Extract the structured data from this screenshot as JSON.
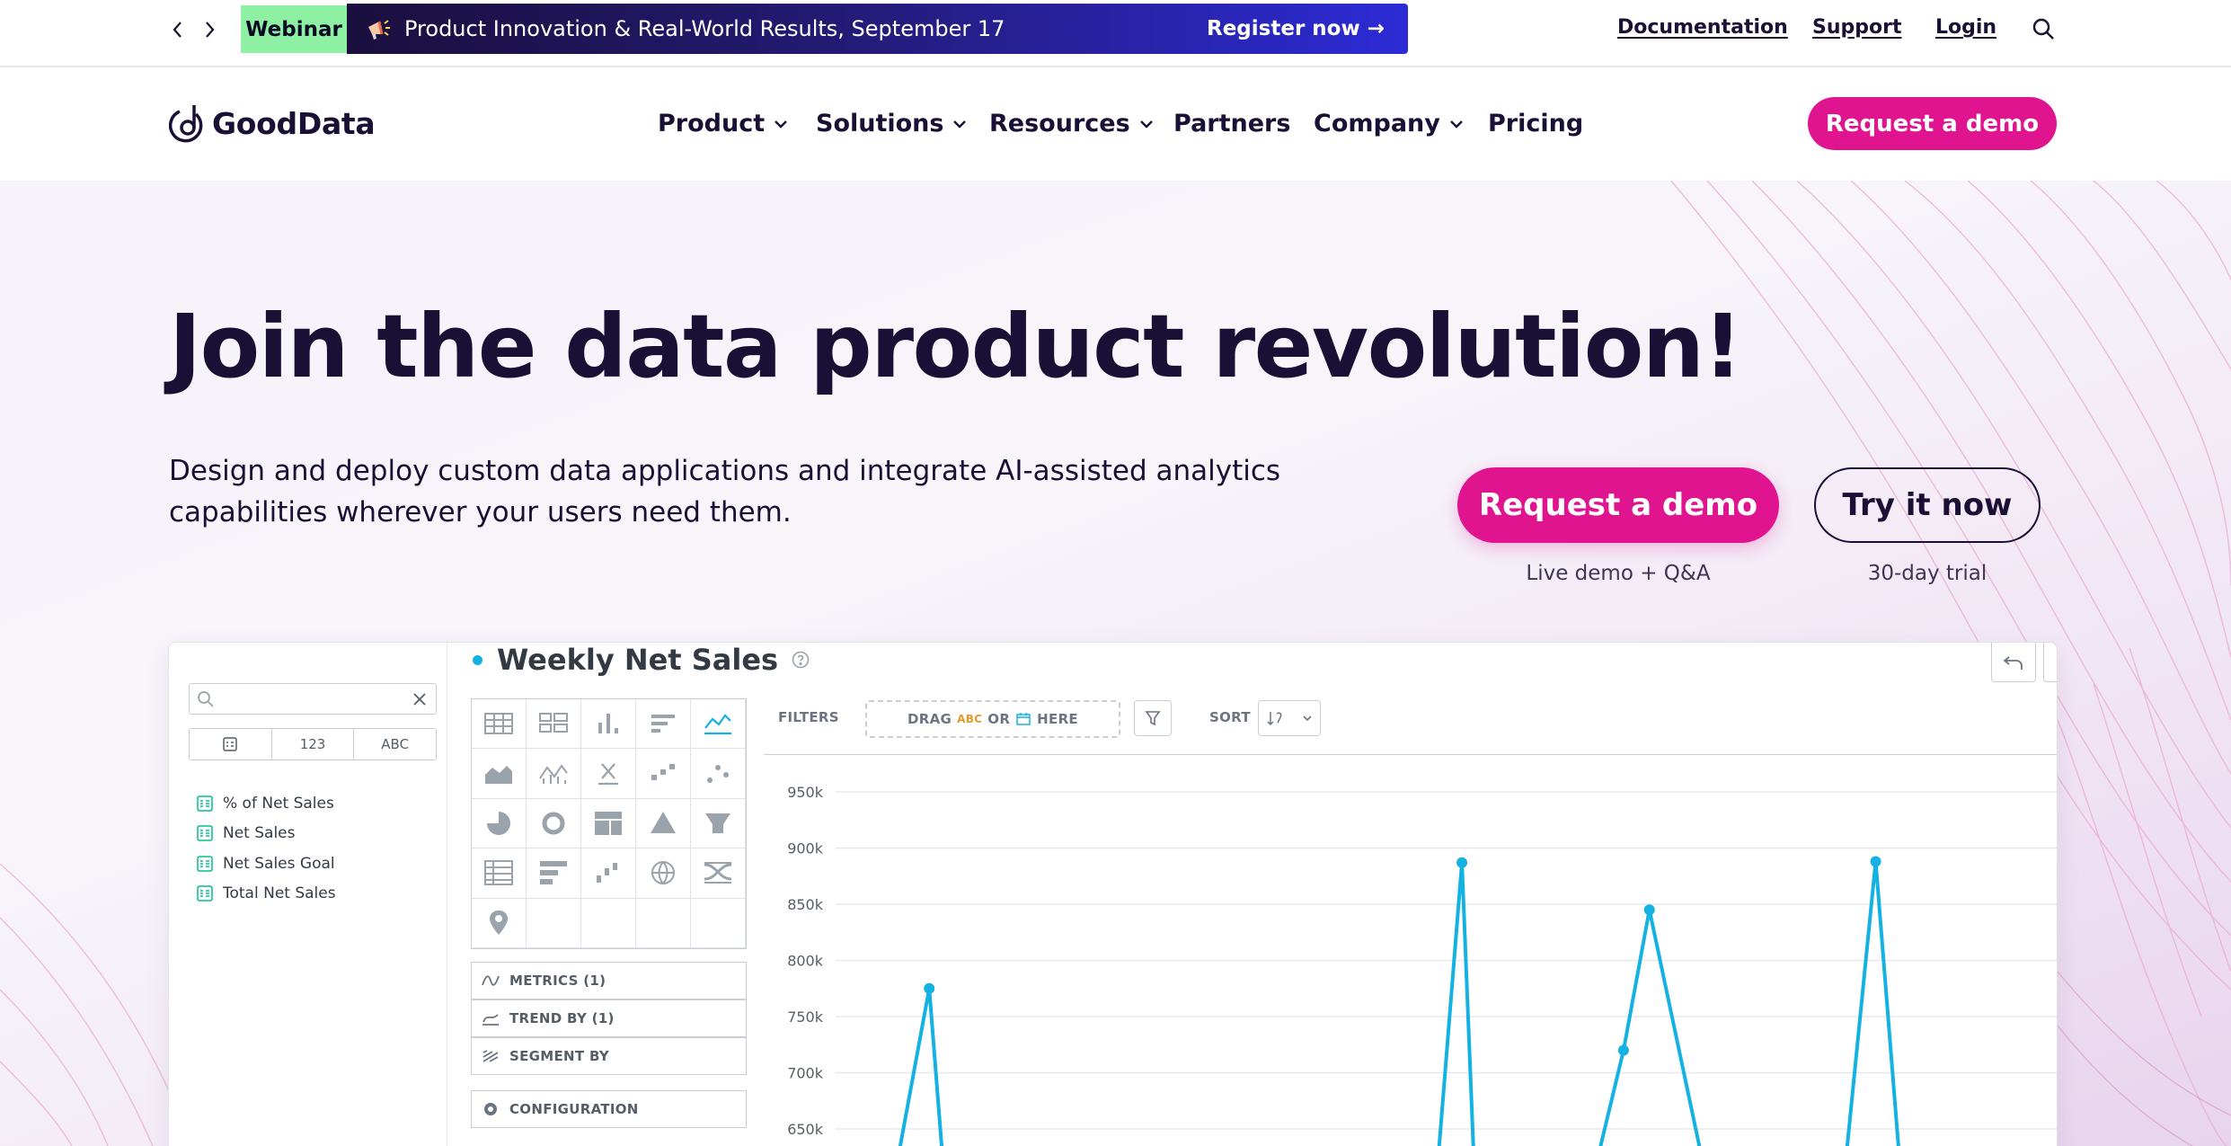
{
  "topbar": {
    "prev_label": "Previous announcement",
    "next_label": "Next announcement",
    "webinar_tag": "Webinar",
    "promo_text": "Product Innovation & Real-World Results, September 17",
    "register_label": "Register now →",
    "links": {
      "documentation": "Documentation",
      "support": "Support",
      "login": "Login"
    }
  },
  "nav": {
    "logo_text": "GoodData",
    "items": {
      "product": "Product",
      "solutions": "Solutions",
      "resources": "Resources",
      "partners": "Partners",
      "company": "Company",
      "pricing": "Pricing"
    },
    "cta": "Request a demo"
  },
  "hero": {
    "title": "Join the data product revolution!",
    "subtitle": "Design and deploy custom data applications and integrate AI-assisted analytics capabilities wherever your users need them.",
    "cta_primary": "Request a demo",
    "cta_primary_note": "Live demo + Q&A",
    "cta_secondary": "Try it now",
    "cta_secondary_note": "30-day trial"
  },
  "mockup": {
    "filter_tabs": {
      "numbers": "123",
      "text": "ABC"
    },
    "metrics": [
      "% of Net Sales",
      "Net Sales",
      "Net Sales Goal",
      "Total Net Sales"
    ],
    "title": "Weekly Net Sales",
    "buckets": {
      "metrics": "METRICS (1)",
      "trend": "TREND BY (1)",
      "segment": "SEGMENT BY",
      "config": "CONFIGURATION"
    },
    "toolbar": {
      "filters_label": "FILTERS",
      "drag_label": "DRAG",
      "abc_label": "ABC",
      "or_label": "OR",
      "here_label": "HERE",
      "sort_label": "SORT"
    },
    "accent_color": "#14b2e2"
  },
  "colors": {
    "brand_pink": "#e0148f",
    "ink": "#1a1036",
    "webinar_green": "#8df0a3"
  },
  "chart_data": {
    "type": "line",
    "title": "Weekly Net Sales",
    "ylim": [
      600000,
      950000
    ],
    "yticks": [
      "950k",
      "900k",
      "850k",
      "800k",
      "750k",
      "700k",
      "650k"
    ],
    "ytick_values": [
      950000,
      900000,
      850000,
      800000,
      750000,
      700000,
      650000
    ],
    "series": [
      {
        "x": [
          0.1,
          0.128,
          0.14,
          0.52,
          0.54,
          0.55,
          0.64,
          0.665,
          0.685,
          0.73,
          0.835,
          0.86,
          0.88,
          0.9
        ],
        "y": [
          600000,
          775000,
          600000,
          600000,
          887000,
          600000,
          600000,
          720000,
          845000,
          600000,
          600000,
          888000,
          600000,
          600000
        ]
      }
    ]
  }
}
